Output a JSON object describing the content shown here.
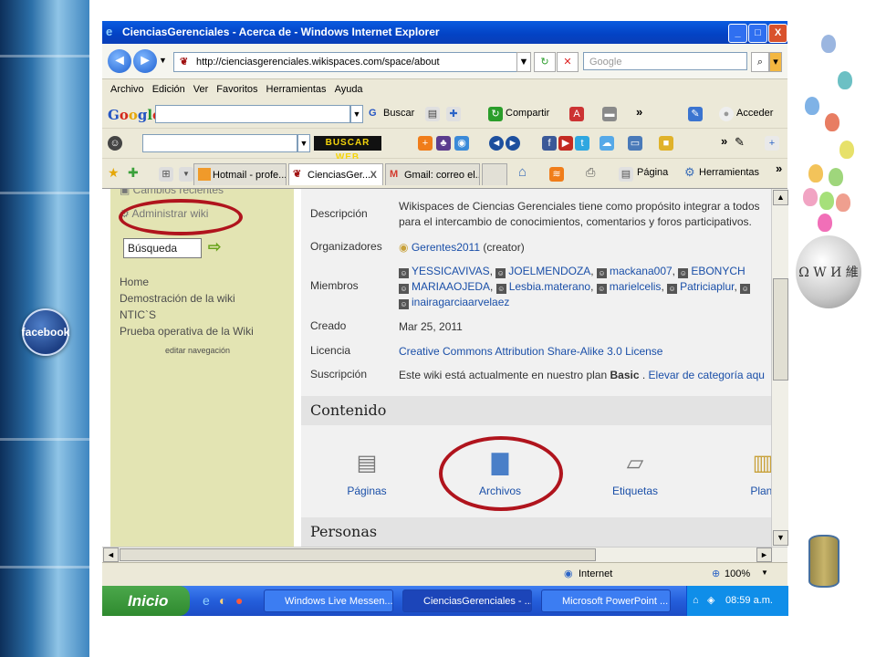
{
  "window": {
    "title": "CienciasGerenciales - Acerca de - Windows Internet Explorer",
    "minimize": "_",
    "maximize": "□",
    "close": "X"
  },
  "address_bar": {
    "url": "http://cienciasgerenciales.wikispaces.com/space/about",
    "search_placeholder": "Google"
  },
  "menu": [
    "Archivo",
    "Edición",
    "Ver",
    "Favoritos",
    "Herramientas",
    "Ayuda"
  ],
  "google_toolbar": {
    "logo": "Google",
    "buscar": "Buscar",
    "compartir": "Compartir",
    "acceder": "Acceder",
    "more": "»"
  },
  "search_toolbar": {
    "buscar_web": "BUSCAR WEB",
    "more": "»"
  },
  "tabs": [
    {
      "label": "Hotmail - profe..."
    },
    {
      "label": "CienciasGer...",
      "close": "X"
    },
    {
      "label": "Gmail: correo el..."
    }
  ],
  "tab_tools": {
    "pagina": "Página",
    "herramientas": "Herramientas",
    "more": "»"
  },
  "sidebar": {
    "cambios": "Cambios recientes",
    "administrar": "Administrar wiki",
    "search_value": "Búsqueda",
    "nav": [
      "Home",
      "Demostración de la wiki",
      "NTIC`S",
      "Prueba operativa de la Wiki"
    ],
    "edit_nav": "editar navegación"
  },
  "about": {
    "descripcion_label": "Descripción",
    "descripcion_line1": "Wikispaces de Ciencias Gerenciales tiene como propósito integrar a todos",
    "descripcion_line2": "para el intercambio de conocimientos, comentarios y foros participativos.",
    "organizadores_label": "Organizadores",
    "organizer": "Gerentes2011",
    "organizer_role": "(creator)",
    "miembros_label": "Miembros",
    "members": [
      "YESSICAVIVAS",
      "JOELMENDOZA",
      "mackana007",
      "EBONYCH",
      "MARIAAOJEDA",
      "Lesbia.materano",
      "marielcelis",
      "Patriciaplur",
      "inairagarciaarvelaez"
    ],
    "creado_label": "Creado",
    "creado": "Mar 25, 2011",
    "licencia_label": "Licencia",
    "licencia": "Creative Commons Attribution Share-Alike 3.0 License",
    "suscripcion_label": "Suscripción",
    "suscripcion_text": "Este wiki está actualmente en nuestro plan",
    "plan": "Basic",
    "upgrade": "Elevar de categoría aqu"
  },
  "contenido": {
    "title": "Contenido",
    "items": [
      "Páginas",
      "Archivos",
      "Etiquetas",
      "Plant"
    ]
  },
  "personas": {
    "title": "Personas"
  },
  "status_bar": {
    "zone": "Internet",
    "zoom": "100%"
  },
  "taskbar": {
    "start": "Inicio",
    "tasks": [
      "Windows Live Messen...",
      "CienciasGerenciales - ...",
      "Microsoft PowerPoint ..."
    ],
    "clock": "08:59 a.m."
  },
  "decor": {
    "facebook": "facebook",
    "globe_glyphs": "Ω W И 維"
  },
  "colors": {
    "highlight_circle": "#b0141d",
    "sidebar_bg": "#e3e4b3",
    "link": "#1a4fa8",
    "titlebar": "#0342c4"
  }
}
